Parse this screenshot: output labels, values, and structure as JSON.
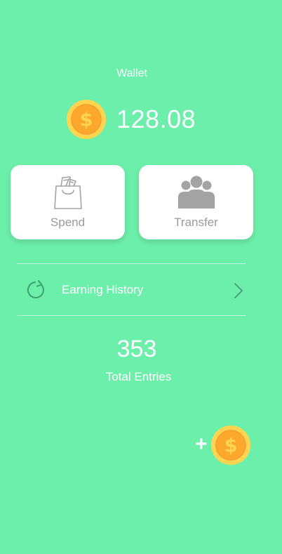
{
  "wallet": {
    "title": "Wallet",
    "balance": "128.08",
    "coin_icon": "dollar-coin-icon"
  },
  "actions": [
    {
      "label": "Spend",
      "icon": "shopping-bag-icon"
    },
    {
      "label": "Transfer",
      "icon": "group-users-icon"
    }
  ],
  "history": {
    "label": "Earning History",
    "icon": "refresh-icon",
    "chevron": "chevron-right-icon"
  },
  "entries": {
    "count": "353",
    "label": "Total Entries"
  },
  "add_coin": {
    "plus": "+",
    "icon": "dollar-coin-icon"
  },
  "colors": {
    "background": "#6cefaa",
    "coin_outer": "#ffd54f",
    "coin_inner": "#fba82d",
    "card": "#ffffff",
    "card_label": "#9a9a9a",
    "icon_gray": "#a3a3a3",
    "refresh_icon": "#3ea774"
  }
}
